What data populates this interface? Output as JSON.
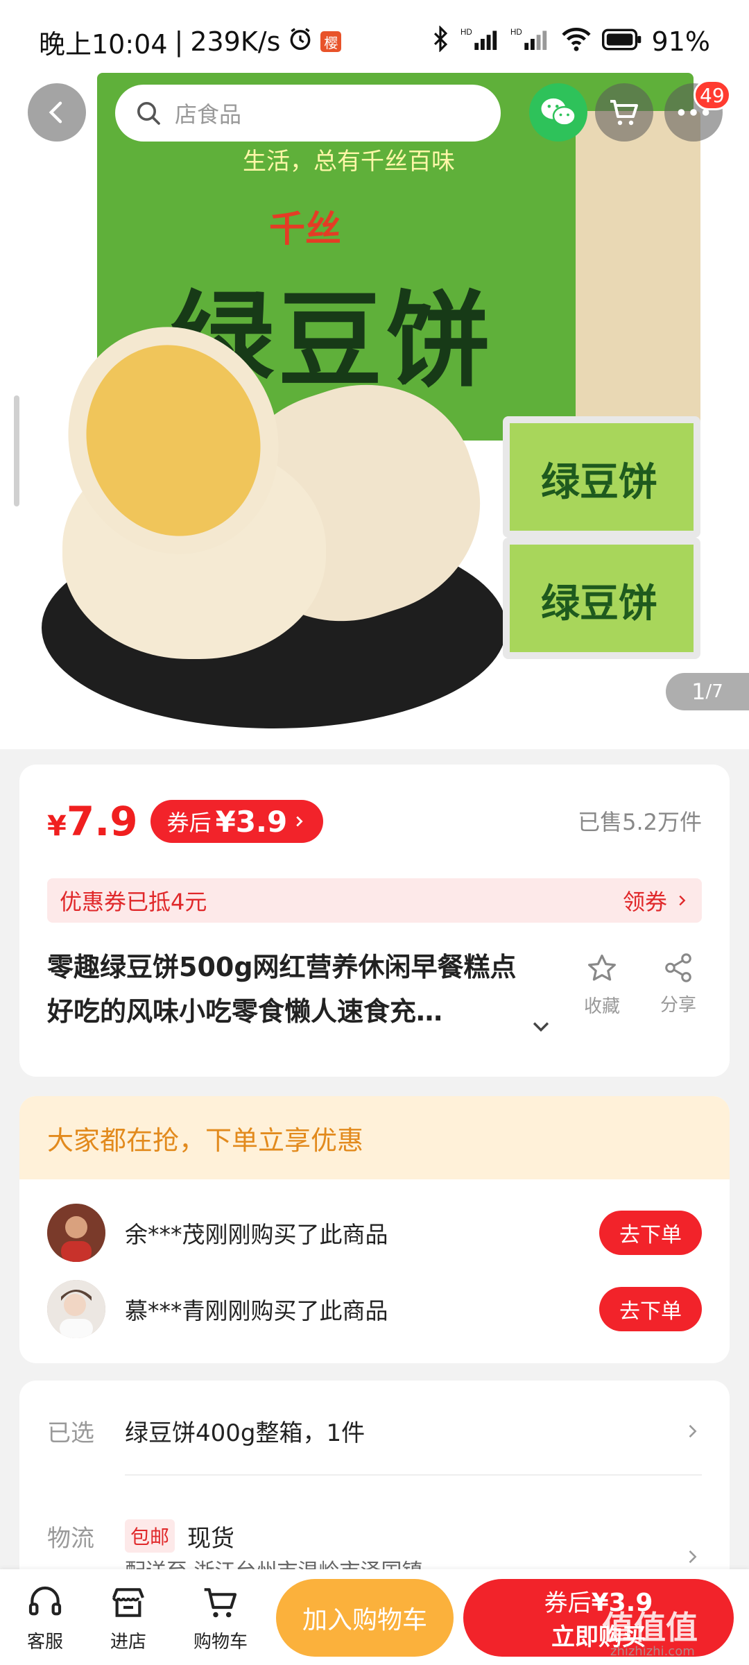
{
  "status_bar": {
    "time": "晚上10:04",
    "speed": "239K/s",
    "app_badge": "樱",
    "battery": "91%"
  },
  "header": {
    "search_placeholder": "店食品",
    "notification_count": "49"
  },
  "gallery": {
    "current": "1",
    "total": "/7"
  },
  "price": {
    "currency": "¥",
    "amount": "7.9",
    "coupon_prefix": "券后",
    "coupon_price": "¥3.9",
    "sold": "已售5.2万件"
  },
  "coupon_bar": {
    "text": "优惠券已抵4元",
    "action": "领券"
  },
  "product": {
    "title": "零趣绿豆饼500g网红营养休闲早餐糕点好吃的风味小吃零食懒人速食充…",
    "collect_label": "收藏",
    "share_label": "分享"
  },
  "hero_text": {
    "slogan": "生活，总有千丝百味",
    "brand": "千丝",
    "name": "绿豆饼",
    "packet_name": "绿豆饼"
  },
  "buyers": {
    "heading": "大家都在抢，下单立享优惠",
    "items": [
      {
        "message": "余***茂刚刚购买了此商品",
        "action": "去下单"
      },
      {
        "message": "慕***青刚刚购买了此商品",
        "action": "去下单"
      }
    ]
  },
  "spec": {
    "selected_label": "已选",
    "selected_value": "绿豆饼400g整箱，1件",
    "logistics_label": "物流",
    "free_shipping": "包邮",
    "stock": "现货",
    "ship_to": "配送至 浙江台州市温岭市泽国镇"
  },
  "bottom_bar": {
    "service": "客服",
    "store": "进店",
    "cart": "购物车",
    "add_to_cart": "加入购物车",
    "buy_line1_prefix": "券后",
    "buy_line1_price": "¥3.9",
    "buy_line2": "立即购买"
  },
  "watermark": {
    "text": "值值值",
    "url": "zhizhizhi.com"
  },
  "colors": {
    "accent_red": "#f2232a",
    "add_cart_orange": "#fbb13c",
    "wechat_green": "#2ec25a"
  }
}
